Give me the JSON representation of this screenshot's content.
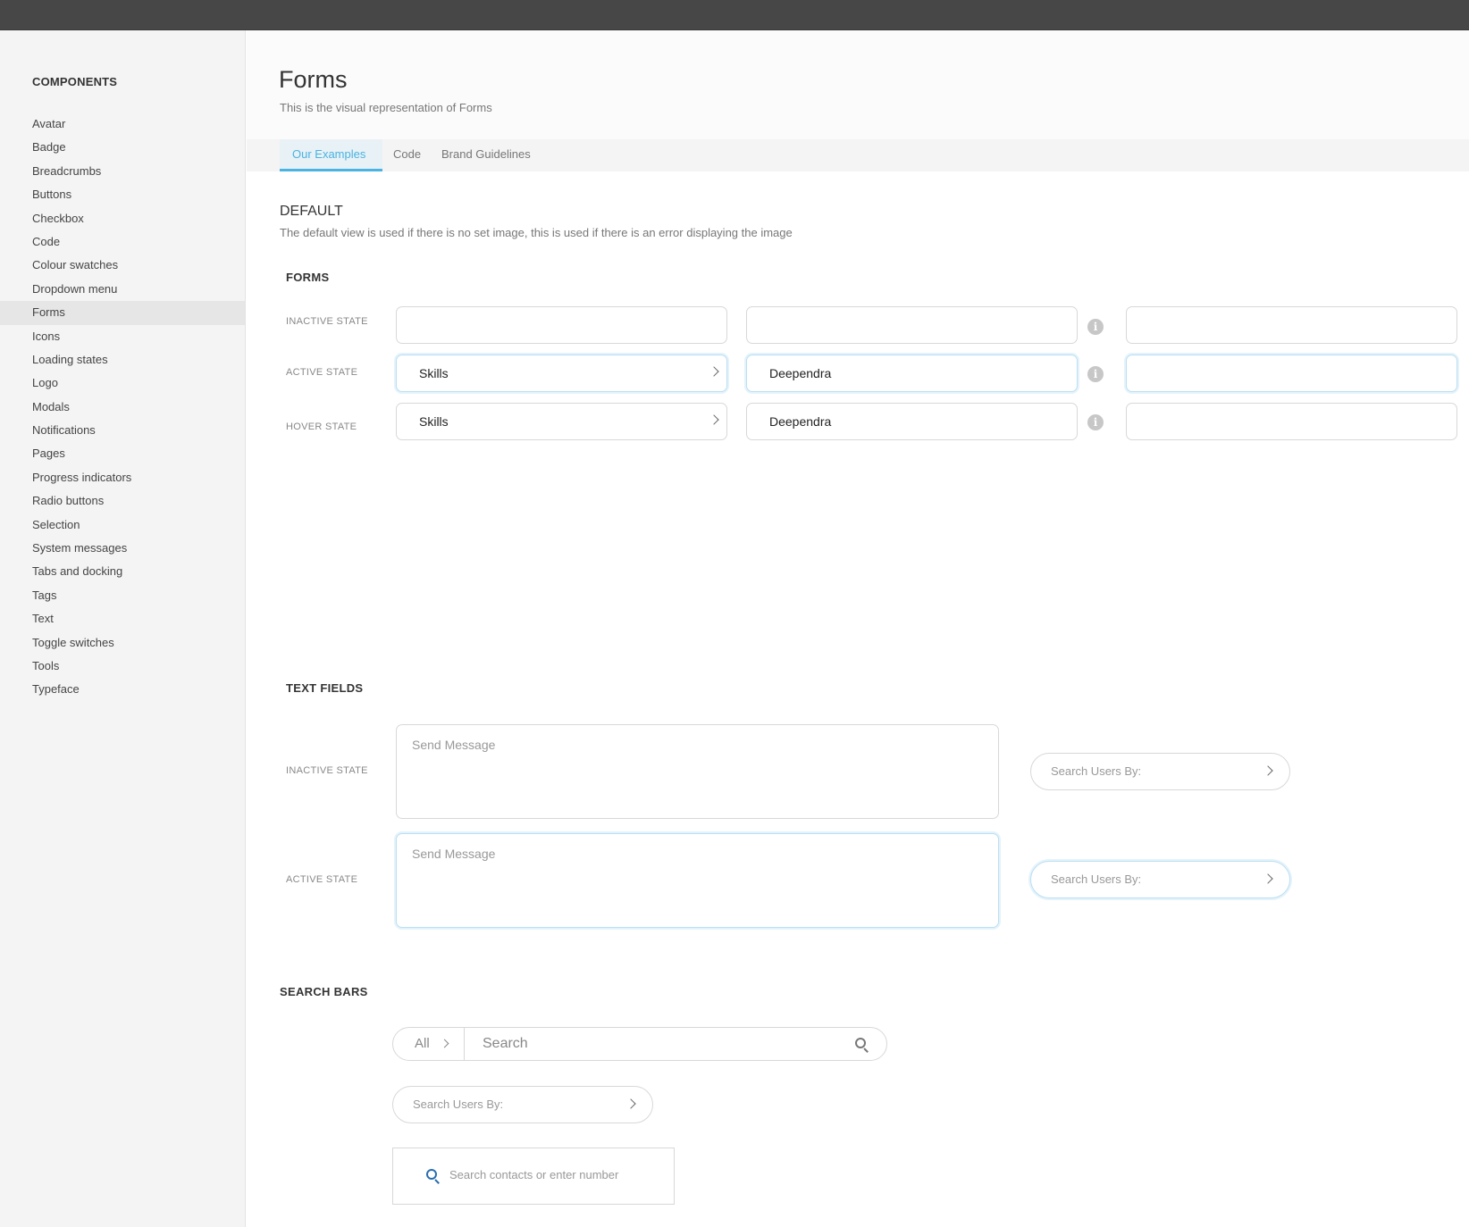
{
  "sidebar": {
    "heading": "COMPONENTS",
    "items": [
      {
        "label": "Avatar"
      },
      {
        "label": "Badge"
      },
      {
        "label": "Breadcrumbs"
      },
      {
        "label": "Buttons"
      },
      {
        "label": "Checkbox"
      },
      {
        "label": "Code"
      },
      {
        "label": "Colour swatches"
      },
      {
        "label": "Dropdown menu"
      },
      {
        "label": "Forms"
      },
      {
        "label": "Icons"
      },
      {
        "label": "Loading states"
      },
      {
        "label": "Logo"
      },
      {
        "label": "Modals"
      },
      {
        "label": "Notifications"
      },
      {
        "label": "Pages"
      },
      {
        "label": "Progress indicators"
      },
      {
        "label": "Radio buttons"
      },
      {
        "label": "Selection"
      },
      {
        "label": "System messages"
      },
      {
        "label": "Tabs and docking"
      },
      {
        "label": "Tags"
      },
      {
        "label": "Text"
      },
      {
        "label": "Toggle switches"
      },
      {
        "label": "Tools"
      },
      {
        "label": "Typeface"
      }
    ],
    "active_item": "Forms"
  },
  "header": {
    "title": "Forms",
    "subtitle": "This is the visual representation of Forms"
  },
  "tabs": [
    {
      "label": "Our Examples",
      "active": true
    },
    {
      "label": "Code",
      "active": false
    },
    {
      "label": "Brand Guidelines",
      "active": false
    }
  ],
  "section": {
    "title": "DEFAULT",
    "description": "The default view is used if there is no set image, this is used if there is an error displaying the image"
  },
  "forms": {
    "title": "FORMS",
    "rows": [
      {
        "label": "INACTIVE STATE",
        "dropdown_value": "",
        "text_value": "",
        "third_value": ""
      },
      {
        "label": "ACTIVE STATE",
        "dropdown_value": "Skills",
        "text_value": "Deependra",
        "third_value": ""
      },
      {
        "label": "HOVER STATE",
        "dropdown_value": "Skills",
        "text_value": "Deependra",
        "third_value": ""
      }
    ],
    "info_glyph": "i"
  },
  "text_fields": {
    "title": "TEXT FIELDS",
    "rows": [
      {
        "label": "INACTIVE STATE",
        "textarea_placeholder": "Send Message",
        "pill_placeholder": "Search Users By:"
      },
      {
        "label": "ACTIVE STATE",
        "textarea_placeholder": "Send Message",
        "pill_placeholder": "Search Users By:"
      }
    ]
  },
  "search_bars": {
    "title": "SEARCH BARS",
    "category": "All",
    "search_placeholder": "Search",
    "users_placeholder": "Search Users By:",
    "contacts_placeholder": "Search contacts or enter number"
  },
  "colors": {
    "accent": "#4ab3e2",
    "topbar": "#474747",
    "sidebar_bg": "#f4f4f4",
    "active_border": "#bcdff2"
  },
  "icons": [
    "info-icon",
    "chevron-right-icon",
    "search-icon"
  ]
}
